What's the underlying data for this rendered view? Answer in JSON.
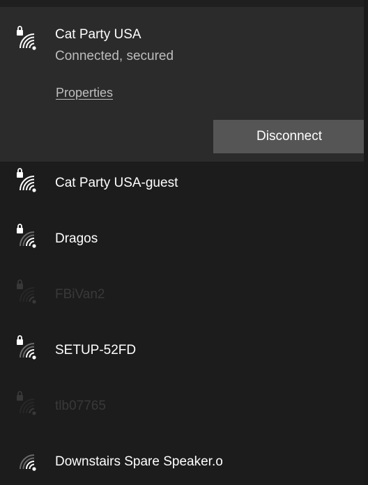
{
  "connected_network": {
    "name": "Cat Party USA",
    "status": "Connected, secured",
    "properties_label": "Properties",
    "disconnect_label": "Disconnect",
    "icon": "wifi-secured-icon"
  },
  "networks": [
    {
      "name": "Cat Party USA-guest",
      "icon": "wifi-secured-icon",
      "secured": true,
      "signal_bars": 4,
      "dimmed": false
    },
    {
      "name": "Dragos",
      "icon": "wifi-secured-icon",
      "secured": true,
      "signal_bars": 2,
      "dimmed": false
    },
    {
      "name": "FBiVan2",
      "icon": "wifi-secured-icon",
      "secured": true,
      "signal_bars": 1,
      "dimmed": true
    },
    {
      "name": "SETUP-52FD",
      "icon": "wifi-secured-icon",
      "secured": true,
      "signal_bars": 2,
      "dimmed": false
    },
    {
      "name": "tlb07765",
      "icon": "wifi-secured-icon",
      "secured": true,
      "signal_bars": 1,
      "dimmed": true
    },
    {
      "name": "Downstairs Spare Speaker.o",
      "icon": "wifi-open-icon",
      "secured": false,
      "signal_bars": 2,
      "dimmed": false
    }
  ],
  "colors": {
    "background": "#1c1c1c",
    "connected_background": "#2b2b2b",
    "button_background": "#555555",
    "text": "#ffffff",
    "secondary_text": "#bdbdbd"
  }
}
